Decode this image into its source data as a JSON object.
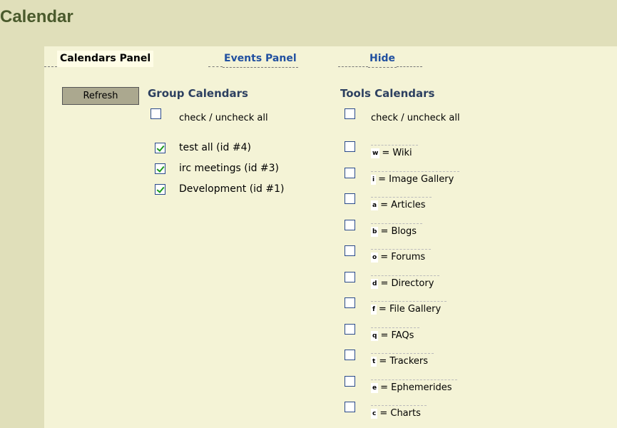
{
  "page": {
    "title": "Calendar"
  },
  "tabs": [
    {
      "label": "Calendars Panel",
      "active": true
    },
    {
      "label": "Events Panel",
      "active": false
    },
    {
      "label": "Hide",
      "active": false
    }
  ],
  "refresh_label": "Refresh",
  "group": {
    "heading": "Group Calendars",
    "check_all_label": "check / uncheck all",
    "check_all_checked": false,
    "items": [
      {
        "label": "test all (id #4)",
        "checked": true
      },
      {
        "label": "irc meetings (id #3)",
        "checked": true
      },
      {
        "label": "Development (id #1)",
        "checked": true
      }
    ]
  },
  "tools": {
    "heading": "Tools Calendars",
    "check_all_label": "check / uncheck all",
    "check_all_checked": false,
    "items": [
      {
        "letter": "w",
        "label": "= Wiki",
        "checked": false
      },
      {
        "letter": "i",
        "label": "= Image Gallery",
        "checked": false
      },
      {
        "letter": "a",
        "label": "= Articles",
        "checked": false
      },
      {
        "letter": "b",
        "label": "= Blogs",
        "checked": false
      },
      {
        "letter": "o",
        "label": "= Forums",
        "checked": false
      },
      {
        "letter": "d",
        "label": "= Directory",
        "checked": false
      },
      {
        "letter": "f",
        "label": "= File Gallery",
        "checked": false
      },
      {
        "letter": "q",
        "label": "= FAQs",
        "checked": false
      },
      {
        "letter": "t",
        "label": "= Trackers",
        "checked": false
      },
      {
        "letter": "e",
        "label": "= Ephemerides",
        "checked": false
      },
      {
        "letter": "c",
        "label": "= Charts",
        "checked": false
      }
    ]
  },
  "colors": {
    "background": "#e0dfba",
    "panel": "#f4f3d6",
    "title": "#4a5a2c",
    "link": "#2150a0",
    "check": "#1c9a1c"
  }
}
